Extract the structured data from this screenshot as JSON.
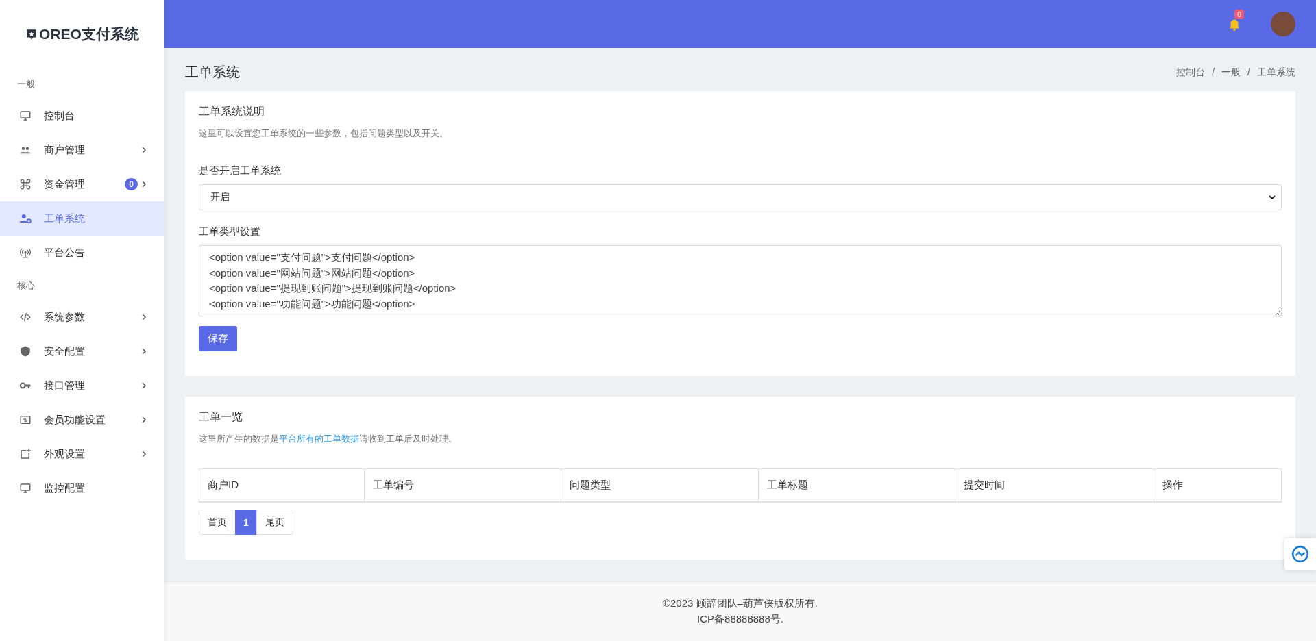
{
  "sidebar": {
    "logo": "OREO支付系统",
    "items": [
      {
        "kind": "section",
        "label": "一般"
      },
      {
        "kind": "item",
        "label": "控制台",
        "selected": false,
        "has_submenu": false
      },
      {
        "kind": "item",
        "label": "商户管理",
        "selected": false,
        "has_submenu": true
      },
      {
        "kind": "item",
        "label": "资金管理",
        "selected": false,
        "has_submenu": true,
        "badge": "0"
      },
      {
        "kind": "item",
        "label": "工单系统",
        "selected": true,
        "has_submenu": false
      },
      {
        "kind": "item",
        "label": "平台公告",
        "selected": false,
        "has_submenu": false
      },
      {
        "kind": "section",
        "label": "核心"
      },
      {
        "kind": "item",
        "label": "系统参数",
        "selected": false,
        "has_submenu": true
      },
      {
        "kind": "item",
        "label": "安全配置",
        "selected": false,
        "has_submenu": true
      },
      {
        "kind": "item",
        "label": "接口管理",
        "selected": false,
        "has_submenu": true
      },
      {
        "kind": "item",
        "label": "会员功能设置",
        "selected": false,
        "has_submenu": true
      },
      {
        "kind": "item",
        "label": "外观设置",
        "selected": false,
        "has_submenu": true
      },
      {
        "kind": "item",
        "label": "监控配置",
        "selected": false,
        "has_submenu": false
      }
    ]
  },
  "header": {
    "notification_count": "0"
  },
  "page": {
    "title": "工单系统",
    "breadcrumb": [
      "控制台",
      "一般",
      "工单系统"
    ],
    "breadcrumb_separator": "/"
  },
  "settings_card": {
    "title": "工单系统说明",
    "description": "这里可以设置您工单系统的一些参数，包括问题类型以及开关。",
    "enable_label": "是否开启工单系统",
    "enable_value": "开启",
    "types_label": "工单类型设置",
    "types_lines": [
      "<option value=\"支付问题\">支付问题</option>",
      "<option value=\"网站问题\">网站问题</option>",
      "<option value=\"提现到账问题\">提现到账问题</option>",
      "<option value=\"功能问题\">功能问题</option>"
    ],
    "save_button": "保存"
  },
  "list_card": {
    "title": "工单一览",
    "description_before": "这里所产生的数据是",
    "description_link": "平台所有的工单数据",
    "description_after": "请收到工单后及时处理。",
    "columns": [
      "商户ID",
      "工单编号",
      "问题类型",
      "工单标题",
      "提交时间",
      "操作"
    ],
    "pagination": [
      {
        "label": "首页",
        "selected": false
      },
      {
        "label": "1",
        "selected": true
      },
      {
        "label": "尾页",
        "selected": false
      }
    ]
  },
  "footer": {
    "copyright": "©2023 顾辞团队–葫芦侠版权所有.",
    "icp": "ICP备88888888号."
  }
}
